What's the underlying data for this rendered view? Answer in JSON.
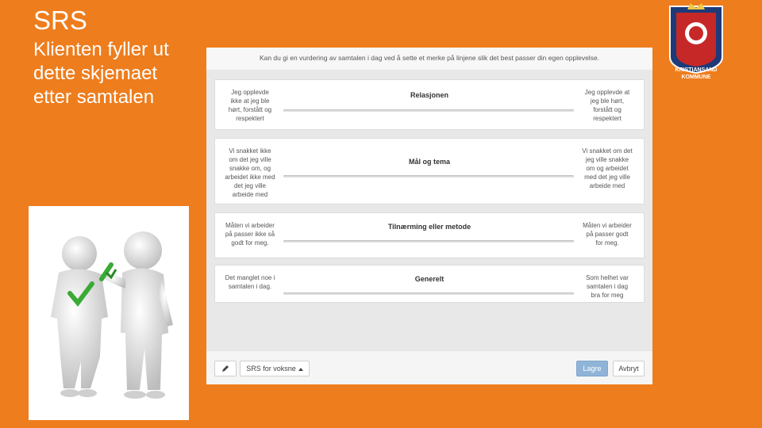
{
  "slide": {
    "title": "SRS",
    "subtitle": "Klienten fyller ut dette skjemaet etter samtalen"
  },
  "crest": {
    "line1": "KRISTIANSAND",
    "line2": "KOMMUNE"
  },
  "form": {
    "instruction": "Kan du gi en vurdering av samtalen i dag ved å sette et merke på linjene slik det best passer din egen opplevelse.",
    "rows": [
      {
        "title": "Relasjonen",
        "left": "Jeg opplevde ikke at jeg ble hørt, forstått og respektert",
        "right": "Jeg opplevde at jeg ble hørt, forstått og respektert"
      },
      {
        "title": "Mål og tema",
        "left": "Vi snakket ikke om det jeg ville snakke om, og arbeidet ikke med det jeg ville arbeide med",
        "right": "Vi snakket om det jeg ville snakke om og arbeidet med det jeg ville arbeide med"
      },
      {
        "title": "Tilnærming eller metode",
        "left": "Måten vi arbeider på passer ikke så godt for meg.",
        "right": "Måten vi arbeider på passer godt for meg."
      },
      {
        "title": "Generelt",
        "left": "Det manglet noe i samtalen i dag.",
        "right": "Som helhet var samtalen i dag bra for meg"
      }
    ],
    "footer": {
      "dropdown_label": "SRS for voksne",
      "save_label": "Lagre",
      "cancel_label": "Avbryt"
    }
  },
  "colors": {
    "background": "#ee7d1d",
    "primary_button": "#8fb4d8",
    "checkmark": "#3aaa35",
    "crest": "#1e3a78"
  }
}
